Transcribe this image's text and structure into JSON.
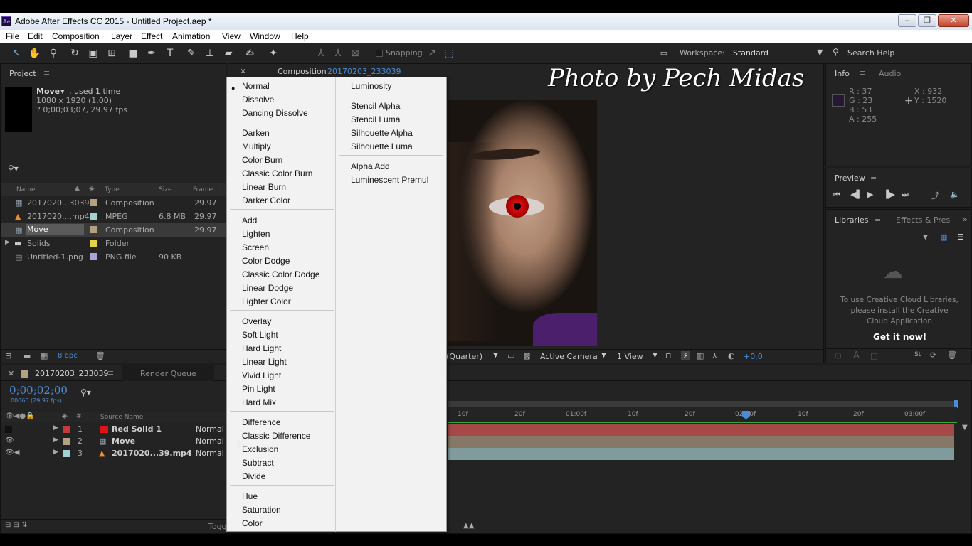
{
  "titlebar": {
    "title": "Adobe After Effects CC 2015 - Untitled Project.aep *",
    "logo": "Ae",
    "minimize": "–",
    "restore": "❐",
    "close": "✕"
  },
  "menubar": [
    "File",
    "Edit",
    "Composition",
    "Layer",
    "Effect",
    "Animation",
    "View",
    "Window",
    "Help"
  ],
  "toolbar": {
    "snapping": "Snapping",
    "workspace_label": "Workspace:",
    "workspace_value": "Standard",
    "search": "Search Help"
  },
  "project": {
    "title": "Project",
    "item_name": "Move",
    "used": ", used 1 time",
    "dims": "1080 x 1920 (1.00)",
    "dur": "? 0;00;03;07, 29.97 fps",
    "columns": {
      "name": "Name",
      "type": "Type",
      "size": "Size",
      "frame": "Frame ..."
    },
    "items": [
      {
        "name": "2017020...3039",
        "type": "Composition",
        "size": "",
        "frame": "29.97",
        "color": "#b4a082"
      },
      {
        "name": "2017020....mp4",
        "type": "MPEG",
        "size": "6.8 MB",
        "frame": "29.97",
        "color": "#a2d2d2"
      },
      {
        "name": "Move",
        "type": "Composition",
        "size": "",
        "frame": "29.97",
        "color": "#b4a082"
      },
      {
        "name": "Solids",
        "type": "Folder",
        "size": "",
        "frame": "",
        "color": "#e6d24a"
      },
      {
        "name": "Untitled-1.png",
        "type": "PNG file",
        "size": "90 KB",
        "frame": "",
        "color": "#a6a6d6"
      }
    ],
    "bpc": "8 bpc"
  },
  "composition": {
    "tab_prefix": "Composition",
    "tab_name": "20170203_233039",
    "quarter": "(Quarter)",
    "camera": "Active Camera",
    "view": "1 View",
    "exposure": "+0.0"
  },
  "info": {
    "title": "Info",
    "audio": "Audio",
    "r": "R : 37",
    "g": "G : 23",
    "b": "B : 53",
    "a": "A : 255",
    "x": "X : 932",
    "y": "Y : 1520",
    "swatch": "#251735"
  },
  "preview": {
    "title": "Preview"
  },
  "libraries": {
    "title": "Libraries",
    "effects": "Effects & Pres",
    "msg": "To use Creative Cloud Libraries, please install the Creative Cloud Application",
    "link": "Get it now!"
  },
  "timeline": {
    "tab": "20170203_233039",
    "render": "Render Queue",
    "timecode": "0;00;02;00",
    "frames": "00060 (29.97 fps)",
    "source_name": "Source Name",
    "toggle": "Toggl",
    "layers": [
      {
        "num": "1",
        "name": "Red Solid 1",
        "mode": "Normal",
        "color": "#c33a3a"
      },
      {
        "num": "2",
        "name": "Move",
        "mode": "Normal",
        "color": "#b4a082"
      },
      {
        "num": "3",
        "name": "2017020...39.mp4",
        "mode": "Normal",
        "color": "#a2d2d2"
      }
    ],
    "ticks": [
      "10f",
      "20f",
      "01:00f",
      "10f",
      "20f",
      "02:00f",
      "10f",
      "20f",
      "03:00f"
    ]
  },
  "blend_menu": {
    "col1": [
      [
        "Normal",
        "Dissolve",
        "Dancing Dissolve"
      ],
      [
        "Darken",
        "Multiply",
        "Color Burn",
        "Classic Color Burn",
        "Linear Burn",
        "Darker Color"
      ],
      [
        "Add",
        "Lighten",
        "Screen",
        "Color Dodge",
        "Classic Color Dodge",
        "Linear Dodge",
        "Lighter Color"
      ],
      [
        "Overlay",
        "Soft Light",
        "Hard Light",
        "Linear Light",
        "Vivid Light",
        "Pin Light",
        "Hard Mix"
      ],
      [
        "Difference",
        "Classic Difference",
        "Exclusion",
        "Subtract",
        "Divide"
      ],
      [
        "Hue",
        "Saturation",
        "Color"
      ]
    ],
    "col2": [
      [
        "Luminosity"
      ],
      [
        "Stencil Alpha",
        "Stencil Luma",
        "Silhouette Alpha",
        "Silhouette Luma"
      ],
      [
        "Alpha Add",
        "Luminescent Premul"
      ]
    ],
    "selected": "Normal"
  },
  "watermark": "Photo by Pech Midas"
}
